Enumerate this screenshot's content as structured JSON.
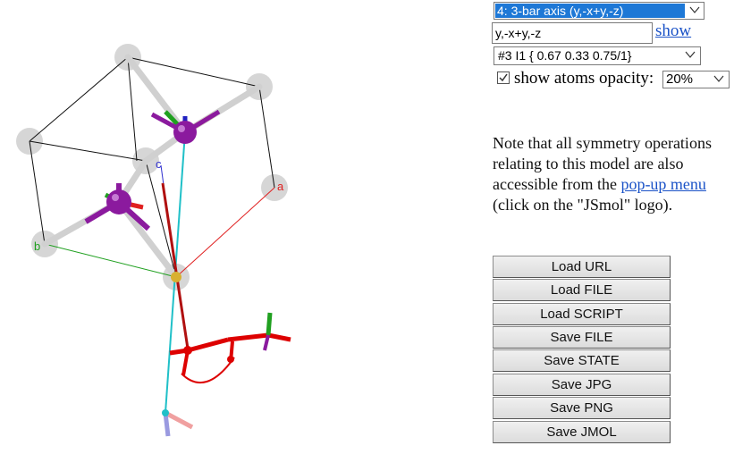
{
  "viewer": {
    "axis_labels": {
      "a": "a",
      "b": "b",
      "c": "c"
    },
    "colors": {
      "axis_a": "#e02020",
      "axis_b": "#20a020",
      "axis_c": "#3030d0",
      "atom": "#8b1a9e",
      "ghost": "#d6d6d6",
      "symop": "#dd0000",
      "cyan": "#20c0c8"
    }
  },
  "controls": {
    "operation_select_value": "4: 3-bar axis (y,-x+y,-z)",
    "operation_input_value": "y,-x+y,-z",
    "show_link": "show",
    "atom_select_value": "#3 I1 { 0.67 0.33 0.75/1}",
    "show_atoms_checked": true,
    "show_atoms_label": "show atoms opacity:",
    "opacity_value": "20%"
  },
  "note": {
    "text_before": "Note that all symmetry operations relating to this model are also accessible from the ",
    "link": "pop-up menu",
    "text_after": " (click on the \"JSmol\" logo)."
  },
  "buttons": [
    {
      "label": "Load URL"
    },
    {
      "label": "Load FILE"
    },
    {
      "label": "Load SCRIPT"
    },
    {
      "label": "Save FILE"
    },
    {
      "label": "Save STATE"
    },
    {
      "label": "Save JPG"
    },
    {
      "label": "Save PNG"
    },
    {
      "label": "Save JMOL"
    }
  ]
}
